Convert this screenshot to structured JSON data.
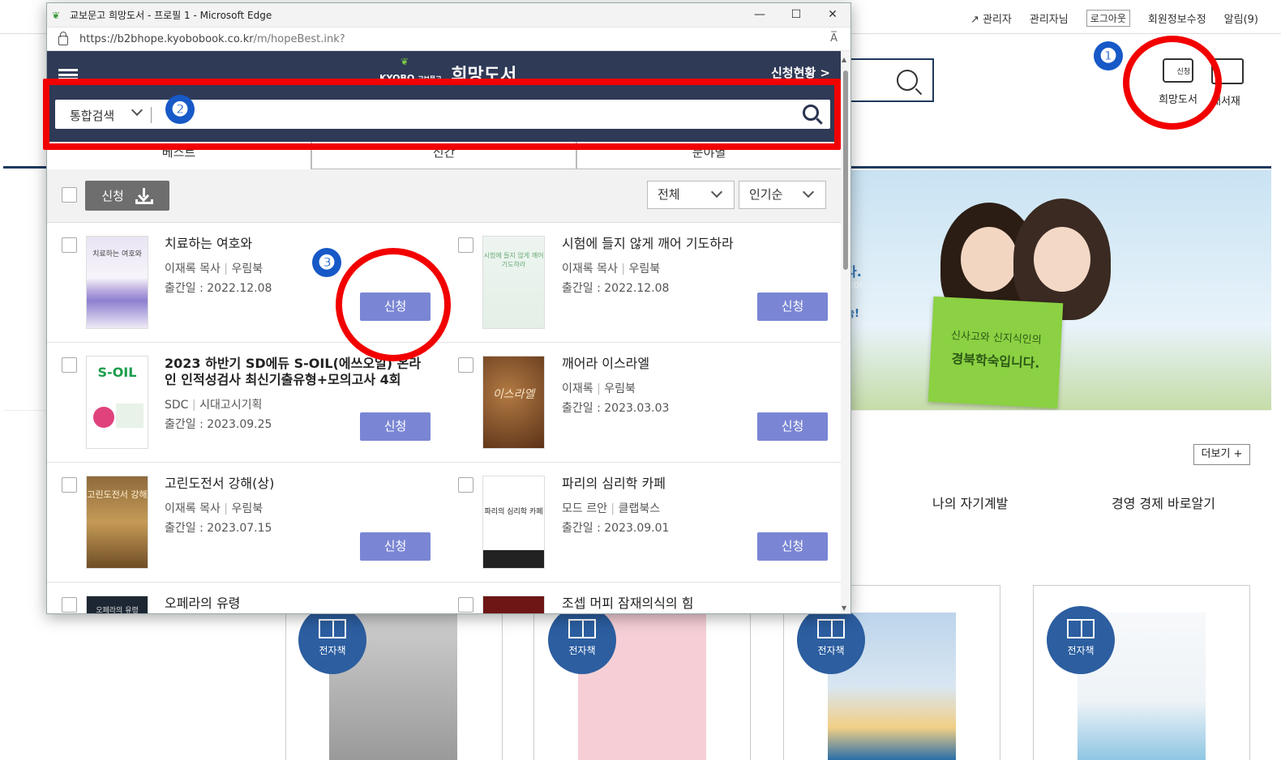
{
  "background": {
    "top_links": [
      "관리자",
      "관리자님",
      "로그아웃",
      "회원정보수정",
      "알림(9)"
    ],
    "hope_label": "희망도서",
    "hope_icon_text": "신청",
    "shelf_label": "내서재",
    "banner": {
      "sign_line1": "신사고와 신지식인의",
      "sign_line2": "경북학숙입니다.",
      "edge_text1": "다.",
      "edge_text2": "TED!",
      "edge_text3": "숙!"
    },
    "more_button": "더보기 +",
    "categories": [
      "나의 자기계발",
      "경영 경제 바로알기"
    ],
    "ebook_badge": "전자책"
  },
  "window": {
    "title": "교보문고 희망도서 - 프로필 1 - Microsoft Edge",
    "url_host": "https://b2bhope.kyobobook.co.kr",
    "url_path": "/m/hopeBest.ink?",
    "read_aloud": "A̅"
  },
  "page": {
    "logo_small": "KYOBO",
    "logo_small2": "교보문고",
    "logo_main": "희망도서",
    "status_link": "신청현황 >",
    "search": {
      "scope": "통합검색",
      "placeholder": ""
    },
    "tabs": [
      "베스트",
      "신간",
      "분야별"
    ],
    "request_all": "신청",
    "filter": "전체",
    "sort": "인기순",
    "request_label": "신청",
    "books": [
      {
        "title": "치료하는 여호와",
        "author": "이재록 목사",
        "publisher": "우림북",
        "date": "출간일 : 2022.12.08"
      },
      {
        "title": "시험에 들지 않게 깨어 기도하라",
        "author": "이재록 목사",
        "publisher": "우림북",
        "date": "출간일 : 2022.12.08"
      },
      {
        "title": "2023 하반기 SD에듀 S-OIL(에쓰오일) 온라인 인적성검사 최신기출유형+모의고사 4회",
        "author": "SDC",
        "publisher": "시대고시기획",
        "date": "출간일 : 2023.09.25"
      },
      {
        "title": "깨어라 이스라엘",
        "author": "이재록",
        "publisher": "우림북",
        "date": "출간일 : 2023.03.03"
      },
      {
        "title": "고린도전서 강해(상)",
        "author": "이재록 목사",
        "publisher": "우림북",
        "date": "출간일 : 2023.07.15"
      },
      {
        "title": "파리의 심리학 카페",
        "author": "모드 르안",
        "publisher": "클랩북스",
        "date": "출간일 : 2023.09.01"
      },
      {
        "title": "오페라의 유령",
        "author": "",
        "publisher": "",
        "date": ""
      },
      {
        "title": "조셉 머피 잠재의식의 힘",
        "author": "",
        "publisher": "",
        "date": ""
      }
    ],
    "cover_texts": [
      "치료하는 여호와",
      "시험에 들지 않게 깨어 기도하라",
      "S-OIL",
      "이스라엘",
      "고린도전서 강해",
      "파리의 심리학 카페",
      "오페라의 유령"
    ]
  },
  "annotations": [
    "❶",
    "❷",
    "❸"
  ]
}
